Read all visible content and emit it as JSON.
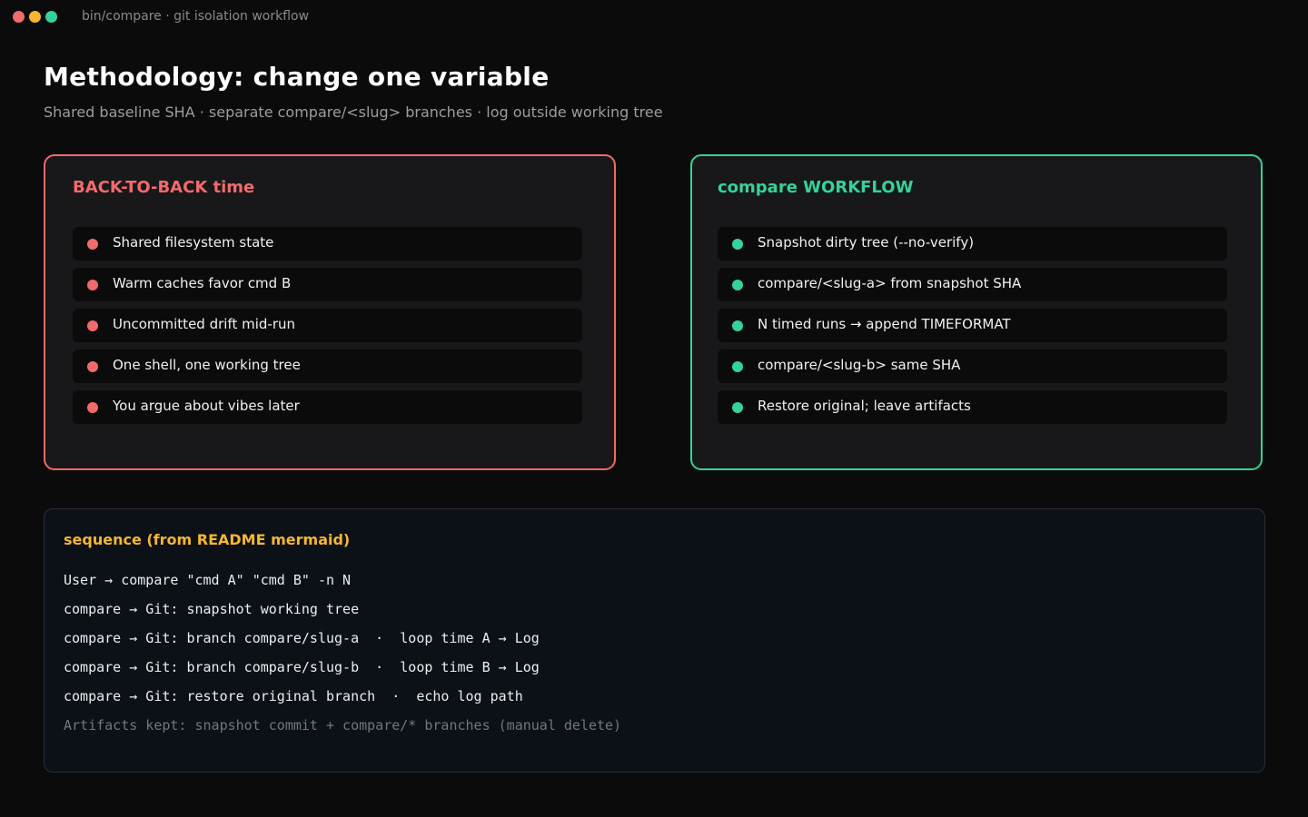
{
  "window": {
    "title": "bin/compare · git isolation workflow",
    "controls": {
      "close_color": "#f26b6b",
      "minimize_color": "#f5b731",
      "maximize_color": "#34d399"
    }
  },
  "header": {
    "title": "Methodology: change one variable",
    "subtitle": "Shared baseline SHA · separate compare/<slug> branches · log outside working tree"
  },
  "back_to_back": {
    "title": "BACK-TO-BACK time",
    "accent": "#f26b6b",
    "items": [
      {
        "label": "Shared filesystem state"
      },
      {
        "label": "Warm caches favor cmd B"
      },
      {
        "label": "Uncommitted drift mid-run"
      },
      {
        "label": "One shell, one working tree"
      },
      {
        "label": "You argue about vibes later"
      }
    ]
  },
  "workflow": {
    "title": "compare WORKFLOW",
    "accent": "#34d399",
    "items": [
      {
        "label": "Snapshot dirty tree (--no-verify)"
      },
      {
        "label": "compare/<slug-a> from snapshot SHA"
      },
      {
        "label": "N timed runs → append TIMEFORMAT"
      },
      {
        "label": "compare/<slug-b> same SHA"
      },
      {
        "label": "Restore original; leave artifacts"
      }
    ]
  },
  "sequence": {
    "title": "sequence (from README mermaid)",
    "accent": "#f5b731",
    "lines": [
      "User → compare \"cmd A\" \"cmd B\" -n N",
      "compare → Git: snapshot working tree",
      "compare → Git: branch compare/slug-a  ·  loop time A → Log",
      "compare → Git: branch compare/slug-b  ·  loop time B → Log",
      "compare → Git: restore original branch  ·  echo log path"
    ],
    "footer": "Artifacts kept: snapshot commit + compare/* branches (manual delete)"
  }
}
